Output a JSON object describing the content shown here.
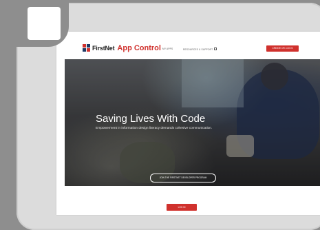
{
  "header": {
    "brand": "FirstNet",
    "app_name": "App Control",
    "nav_links": [
      "MY APPS",
      "RESOURCES & SUPPORT"
    ],
    "cta_label": "CREATE OR LOG IN"
  },
  "hero": {
    "title": "Saving Lives With Code",
    "subtitle": "Empowerment in information design literacy demands cohesive communication.",
    "outline_button": "JOIN THE FIRSTNET DEVELOPER PROGRAM",
    "primary_button": "LOG IN"
  },
  "colors": {
    "accent": "#d0312d",
    "frame": "#dcdcdc",
    "background": "#8e8e8e"
  }
}
